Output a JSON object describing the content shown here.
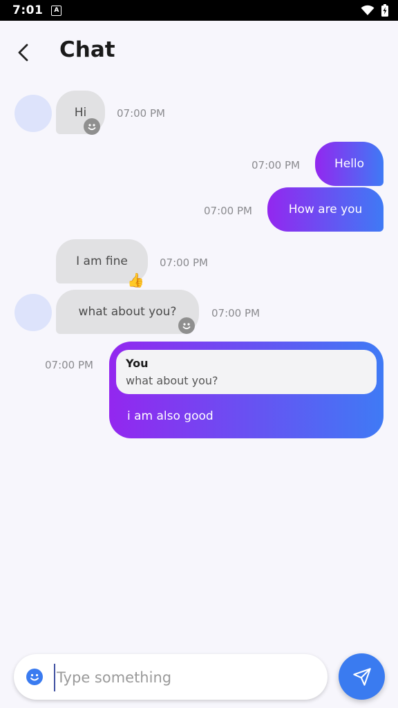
{
  "status_bar": {
    "time": "7:01",
    "notification_icon": "A"
  },
  "header": {
    "title": "Chat",
    "back_icon": "chevron-left-icon"
  },
  "messages": [
    {
      "direction": "incoming",
      "text": "Hi",
      "time": "07:00 PM",
      "reaction": "smiley-icon",
      "avatar": true
    },
    {
      "direction": "outgoing",
      "text": "Hello",
      "time": "07:00 PM"
    },
    {
      "direction": "outgoing",
      "text": "How are you",
      "time": "07:00 PM"
    },
    {
      "direction": "incoming",
      "text": "I am fine",
      "time": "07:00 PM",
      "reaction": "👍",
      "avatar": false
    },
    {
      "direction": "incoming",
      "text": "what about you?",
      "time": "07:00 PM",
      "reaction": "smiley-icon",
      "avatar": true
    },
    {
      "direction": "outgoing",
      "text": "i am also good",
      "time": "07:00 PM",
      "reply_to": {
        "author": "You",
        "text": "what about you?"
      }
    }
  ],
  "composer": {
    "placeholder": "Type something",
    "value": ""
  },
  "colors": {
    "gradient_start": "#9327ef",
    "gradient_end": "#3f7af5",
    "incoming_bubble": "#e1e1e3",
    "send_button": "#3a7bf0"
  }
}
